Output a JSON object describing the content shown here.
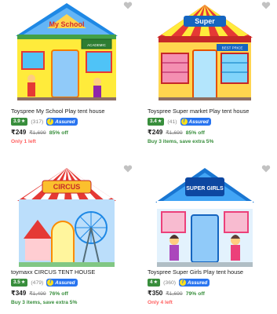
{
  "products": [
    {
      "title": "Toyspree My School Play tent house",
      "rating": "3.9",
      "reviews": "(317)",
      "assured": "Assured",
      "price": "₹249",
      "mrp": "₹1,699",
      "discount": "85% off",
      "note": "Only 1 left",
      "note_color": "#ff6161",
      "image_text": "My School",
      "image_sign": "ACADEMIC"
    },
    {
      "title": "Toyspree Super market Play tent house",
      "rating": "3.4",
      "reviews": "(41)",
      "assured": "Assured",
      "price": "₹249",
      "mrp": "₹1,699",
      "discount": "85% off",
      "note": "Buy 3 items, save extra 5%",
      "note_color": "#388e3c",
      "image_text": "Super",
      "image_sign": "BEST PRICE"
    },
    {
      "title": "toymaxx CIRCUS TENT HOUSE",
      "rating": "3.5",
      "reviews": "(479)",
      "assured": "Assured",
      "price": "₹349",
      "mrp": "₹1,499",
      "discount": "76% off",
      "note": "Buy 3 items, save extra 5%",
      "note_color": "#388e3c",
      "image_text": "CIRCUS"
    },
    {
      "title": "Toyspree Super Girls Play tent house",
      "rating": "4",
      "reviews": "(360)",
      "assured": "Assured",
      "price": "₹350",
      "mrp": "₹1,699",
      "discount": "79% off",
      "note": "Only 4 left",
      "note_color": "#ff6161",
      "image_text": "SUPER GIRLS"
    }
  ],
  "icons": {
    "wishlist": "heart-icon",
    "rating_star": "star-icon",
    "assured_badge": "plus-badge-icon"
  },
  "colors": {
    "rating_badge": "#388e3c",
    "assured_badge": "#2874f0",
    "discount": "#388e3c",
    "stock_warning": "#ff6161"
  }
}
